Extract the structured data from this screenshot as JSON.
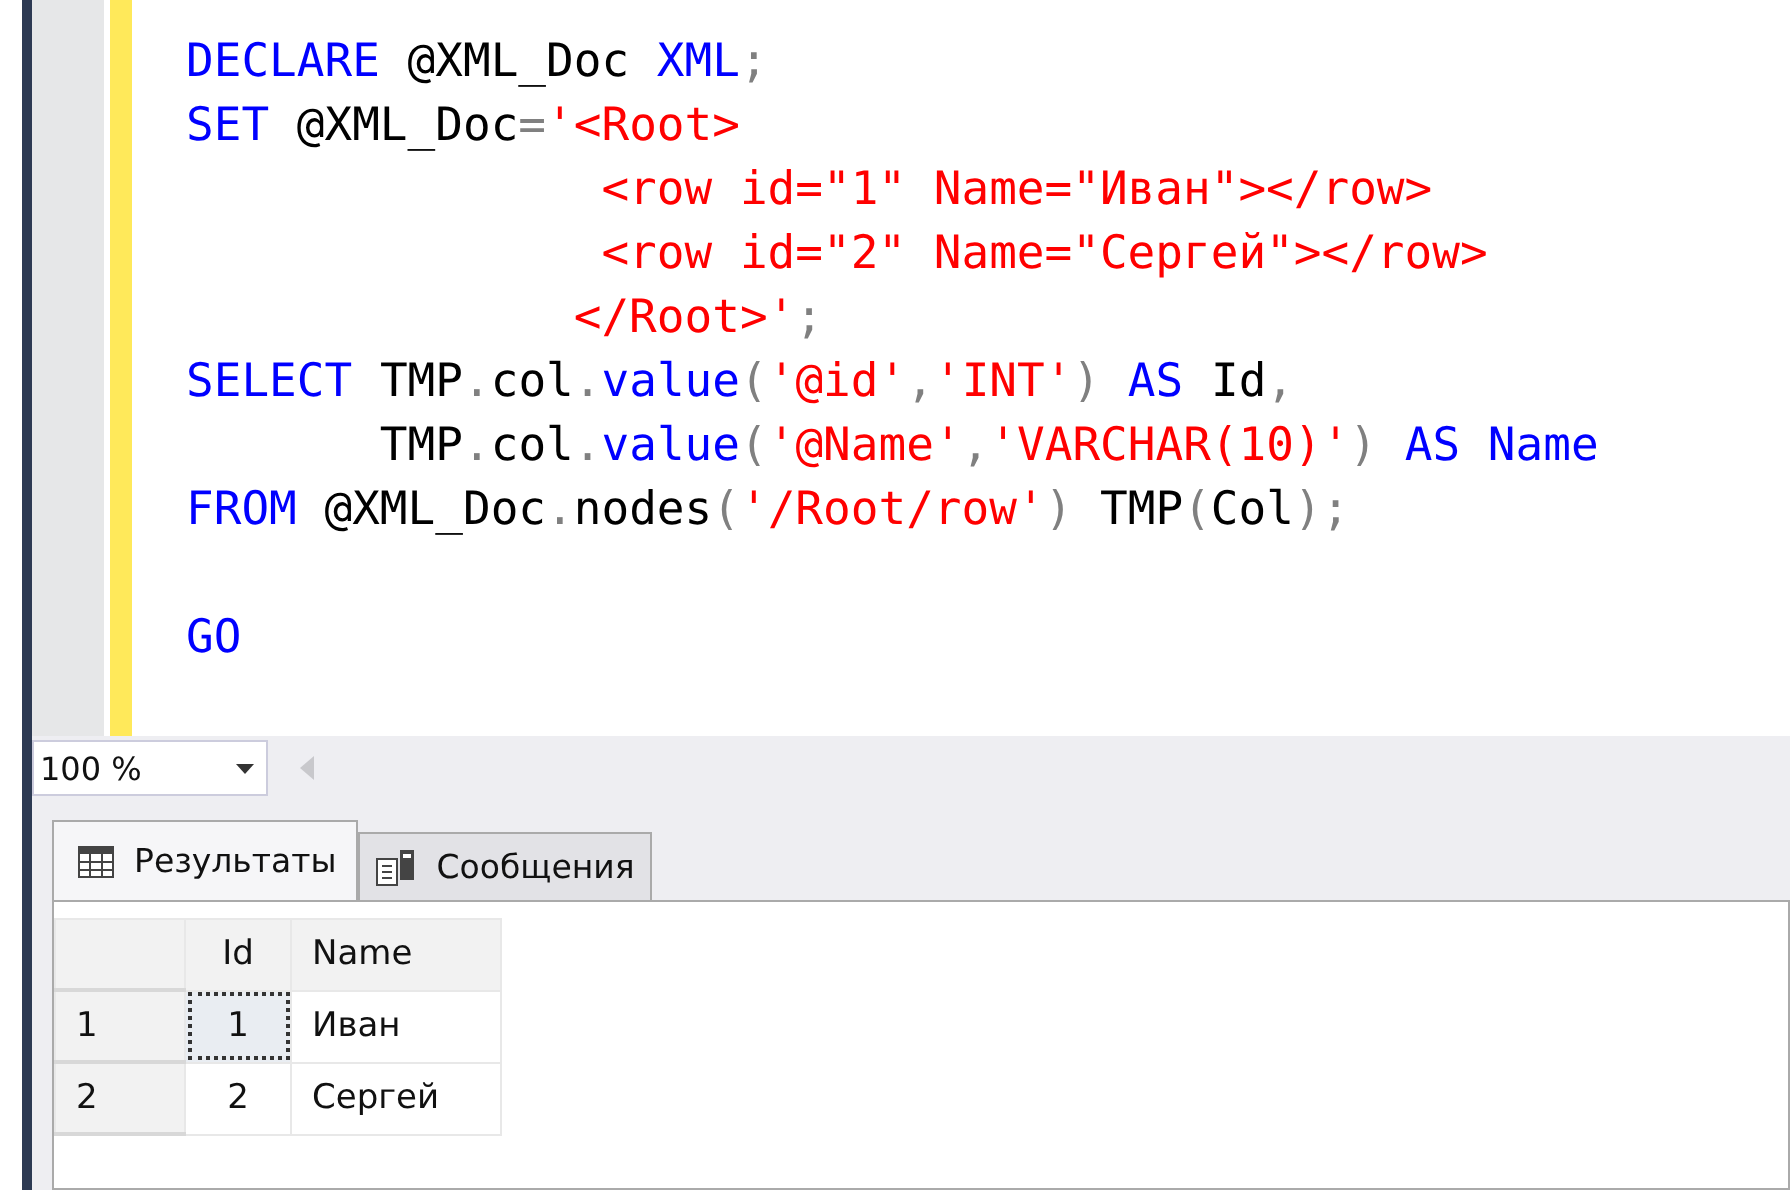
{
  "editor": {
    "blocks": [
      {
        "lines": [
          [
            {
              "text": "DECLARE",
              "kind": "kw"
            },
            {
              "text": " @XML_Doc ",
              "kind": "plain"
            },
            {
              "text": "XML",
              "kind": "kw"
            },
            {
              "text": ";",
              "kind": "punct"
            }
          ],
          [
            {
              "text": "SET",
              "kind": "kw"
            },
            {
              "text": " @XML_Doc",
              "kind": "plain"
            },
            {
              "text": "=",
              "kind": "punct"
            },
            {
              "text": "'<Root>",
              "kind": "str"
            }
          ],
          [
            {
              "text": "               <row id=\"1\" Name=\"Иван\"></row>",
              "kind": "str"
            }
          ],
          [
            {
              "text": "               <row id=\"2\" Name=\"Сергей\"></row>",
              "kind": "str"
            }
          ],
          [
            {
              "text": "              </Root>'",
              "kind": "str"
            },
            {
              "text": ";",
              "kind": "punct"
            }
          ],
          [
            {
              "text": "SELECT",
              "kind": "kw"
            },
            {
              "text": " TMP",
              "kind": "plain"
            },
            {
              "text": ".",
              "kind": "punct"
            },
            {
              "text": "col",
              "kind": "plain"
            },
            {
              "text": ".",
              "kind": "punct"
            },
            {
              "text": "value",
              "kind": "kw"
            },
            {
              "text": "(",
              "kind": "punct"
            },
            {
              "text": "'@id'",
              "kind": "str"
            },
            {
              "text": ",",
              "kind": "punct"
            },
            {
              "text": "'INT'",
              "kind": "str"
            },
            {
              "text": ") ",
              "kind": "punct"
            },
            {
              "text": "AS",
              "kind": "kw"
            },
            {
              "text": " Id",
              "kind": "plain"
            },
            {
              "text": ",",
              "kind": "punct"
            }
          ],
          [
            {
              "text": "       TMP",
              "kind": "plain"
            },
            {
              "text": ".",
              "kind": "punct"
            },
            {
              "text": "col",
              "kind": "plain"
            },
            {
              "text": ".",
              "kind": "punct"
            },
            {
              "text": "value",
              "kind": "kw"
            },
            {
              "text": "(",
              "kind": "punct"
            },
            {
              "text": "'@Name'",
              "kind": "str"
            },
            {
              "text": ",",
              "kind": "punct"
            },
            {
              "text": "'VARCHAR(10)'",
              "kind": "str"
            },
            {
              "text": ") ",
              "kind": "punct"
            },
            {
              "text": "AS",
              "kind": "kw"
            },
            {
              "text": " Name",
              "kind": "kw"
            }
          ],
          [
            {
              "text": "FROM",
              "kind": "kw"
            },
            {
              "text": " @XML_Doc",
              "kind": "plain"
            },
            {
              "text": ".",
              "kind": "punct"
            },
            {
              "text": "nodes",
              "kind": "plain"
            },
            {
              "text": "(",
              "kind": "punct"
            },
            {
              "text": "'/Root/row'",
              "kind": "str"
            },
            {
              "text": ") ",
              "kind": "punct"
            },
            {
              "text": "TMP",
              "kind": "plain"
            },
            {
              "text": "(",
              "kind": "punct"
            },
            {
              "text": "Col",
              "kind": "plain"
            },
            {
              "text": ");",
              "kind": "punct"
            }
          ]
        ]
      },
      {
        "lines": [
          [
            {
              "text": "GO",
              "kind": "kw"
            }
          ]
        ]
      }
    ]
  },
  "zoom": {
    "value": "100 %"
  },
  "tabs": [
    {
      "label": "Результаты",
      "selected": true,
      "kind": "grid"
    },
    {
      "label": "Сообщения",
      "selected": false,
      "kind": "messages"
    }
  ],
  "grid": {
    "columns": [
      "Id",
      "Name"
    ],
    "rows": [
      {
        "number": "1",
        "cells": [
          {
            "text": "1",
            "focused": true
          },
          {
            "text": "Иван",
            "focused": false
          }
        ]
      },
      {
        "number": "2",
        "cells": [
          {
            "text": "2",
            "focused": false
          },
          {
            "text": "Сергей",
            "focused": false
          }
        ]
      }
    ]
  }
}
